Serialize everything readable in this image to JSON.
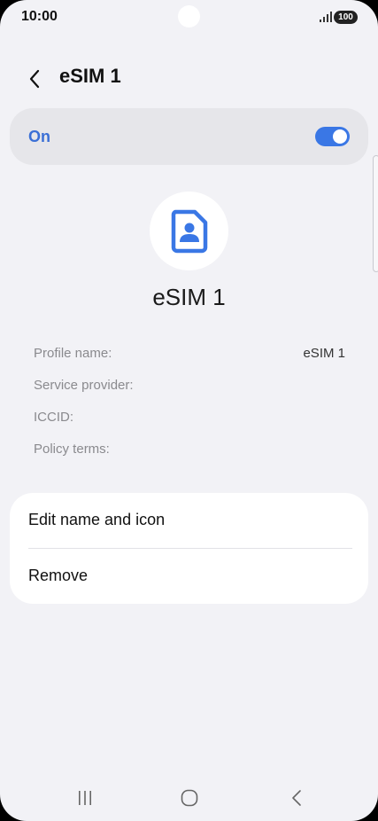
{
  "status_bar": {
    "time": "10:00",
    "battery": "100"
  },
  "header": {
    "title": "eSIM 1"
  },
  "toggle": {
    "label": "On",
    "state": "on"
  },
  "profile": {
    "name": "eSIM 1"
  },
  "info": [
    {
      "label": "Profile name:",
      "value": "eSIM 1"
    },
    {
      "label": "Service provider:",
      "value": ""
    },
    {
      "label": "ICCID:",
      "value": ""
    },
    {
      "label": "Policy terms:",
      "value": ""
    }
  ],
  "actions": {
    "edit_label": "Edit name and icon",
    "remove_label": "Remove"
  },
  "colors": {
    "accent": "#3a77e5",
    "background": "#f2f2f6"
  },
  "icons": {
    "back": "chevron-left-icon",
    "profile": "sim-card-person-icon",
    "nav_recents": "recents-icon",
    "nav_home": "home-icon",
    "nav_back": "back-icon"
  }
}
